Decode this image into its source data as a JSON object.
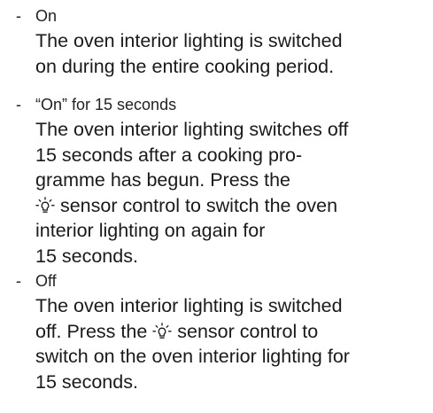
{
  "options": [
    {
      "dash": "-",
      "label": "On",
      "lines": [
        "The oven interior lighting is switched",
        "on during the entire cooking period."
      ]
    },
    {
      "dash": "-",
      "label": "“On” for 15 seconds",
      "lines": [
        "The oven interior lighting switches off",
        "15 seconds after a cooking pro-",
        "gramme has begun. Press the",
        " sensor control to switch the oven",
        "interior lighting on again for",
        "15 seconds."
      ]
    },
    {
      "dash": "-",
      "label": "Off",
      "lines": [
        "The oven interior lighting is switched",
        "off. Press the ",
        " sensor control to",
        "switch on the oven interior lighting for",
        "15 seconds."
      ]
    }
  ],
  "icons": {
    "light": "light-bulb-icon"
  }
}
